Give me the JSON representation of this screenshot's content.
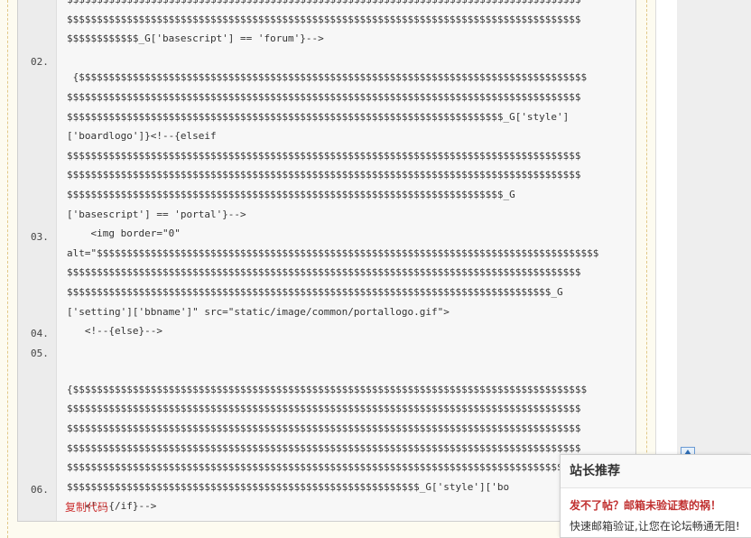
{
  "code_block": {
    "line_numbers": [
      "02.",
      "03.",
      "04.",
      "05.",
      "06."
    ],
    "code_text": "$$$$$$$$$$$$$$$$$$$$$$$$$$$$$$$$$$$$$$$$$$$$$$$$$$$$$$$$$$$$$$$$$$$$$$$$$$$$$$$$$$$$$$\n$$$$$$$$$$$$$$$$$$$$$$$$$$$$$$$$$$$$$$$$$$$$$$$$$$$$$$$$$$$$$$$$$$$$$$$$$$$$$$$$$$$$$$\n$$$$$$$$$$$$_G['basescript'] == 'forum'}-->\n\n {$$$$$$$$$$$$$$$$$$$$$$$$$$$$$$$$$$$$$$$$$$$$$$$$$$$$$$$$$$$$$$$$$$$$$$$$$$$$$$$$$$$$$\n$$$$$$$$$$$$$$$$$$$$$$$$$$$$$$$$$$$$$$$$$$$$$$$$$$$$$$$$$$$$$$$$$$$$$$$$$$$$$$$$$$$$$$\n$$$$$$$$$$$$$$$$$$$$$$$$$$$$$$$$$$$$$$$$$$$$$$$$$$$$$$$$$$$$$$$$$$$$$$$$$_G['style']\n['boardlogo']}<!--{elseif\n$$$$$$$$$$$$$$$$$$$$$$$$$$$$$$$$$$$$$$$$$$$$$$$$$$$$$$$$$$$$$$$$$$$$$$$$$$$$$$$$$$$$$$\n$$$$$$$$$$$$$$$$$$$$$$$$$$$$$$$$$$$$$$$$$$$$$$$$$$$$$$$$$$$$$$$$$$$$$$$$$$$$$$$$$$$$$$\n$$$$$$$$$$$$$$$$$$$$$$$$$$$$$$$$$$$$$$$$$$$$$$$$$$$$$$$$$$$$$$$$$$$$$$$$$_G\n['basescript'] == 'portal'}-->\n    <img border=\"0\"\nalt=\"$$$$$$$$$$$$$$$$$$$$$$$$$$$$$$$$$$$$$$$$$$$$$$$$$$$$$$$$$$$$$$$$$$$$$$$$$$$$$$$$$$$$\n$$$$$$$$$$$$$$$$$$$$$$$$$$$$$$$$$$$$$$$$$$$$$$$$$$$$$$$$$$$$$$$$$$$$$$$$$$$$$$$$$$$$$$\n$$$$$$$$$$$$$$$$$$$$$$$$$$$$$$$$$$$$$$$$$$$$$$$$$$$$$$$$$$$$$$$$$$$$$$$$$$$$$$$$$_G\n['setting']['bbname']\" src=\"static/image/common/portallogo.gif\">\n   <!--{else}-->\n\n\n{$$$$$$$$$$$$$$$$$$$$$$$$$$$$$$$$$$$$$$$$$$$$$$$$$$$$$$$$$$$$$$$$$$$$$$$$$$$$$$$$$$$$$$\n$$$$$$$$$$$$$$$$$$$$$$$$$$$$$$$$$$$$$$$$$$$$$$$$$$$$$$$$$$$$$$$$$$$$$$$$$$$$$$$$$$$$$$\n$$$$$$$$$$$$$$$$$$$$$$$$$$$$$$$$$$$$$$$$$$$$$$$$$$$$$$$$$$$$$$$$$$$$$$$$$$$$$$$$$$$$$$\n$$$$$$$$$$$$$$$$$$$$$$$$$$$$$$$$$$$$$$$$$$$$$$$$$$$$$$$$$$$$$$$$$$$$$$$$$$$$$$$$$$$$$$\n$$$$$$$$$$$$$$$$$$$$$$$$$$$$$$$$$$$$$$$$$$$$$$$$$$$$$$$$$$$$$$$$$$$$$$$$$$$$$$$$$$$$$$\n$$$$$$$$$$$$$$$$$$$$$$$$$$$$$$$$$$$$$$$$$$$$$$$$$$$$$$$$$$$_G['style']['bo\n   <!--{/if}-->",
    "copy_label": "复制代码"
  },
  "popup": {
    "title": "站长推荐",
    "link_text": "发不了帖？邮箱未验证惹的祸！",
    "desc_text": "快速邮箱验证,让您在论坛畅通无阻!"
  }
}
